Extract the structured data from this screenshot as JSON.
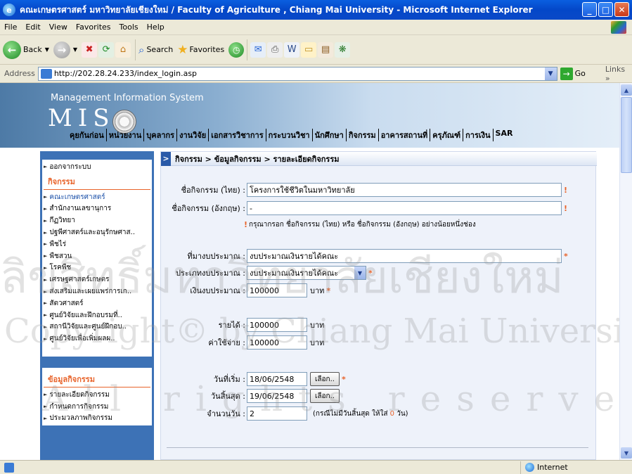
{
  "window": {
    "title": "คณะเกษตรศาสตร์ มหาวิทยาลัยเชียงใหม่ / Faculty of Agriculture , Chiang Mai University   - Microsoft Internet Explorer"
  },
  "menu": [
    "File",
    "Edit",
    "View",
    "Favorites",
    "Tools",
    "Help"
  ],
  "toolbar": {
    "back": "Back",
    "search": "Search",
    "favorites": "Favorites"
  },
  "address": {
    "label": "Address",
    "url": "http://202.28.24.233/index_login.asp",
    "go": "Go",
    "links": "Links"
  },
  "header": {
    "subtitle": "Management Information System",
    "logo": "MIS",
    "nav": [
      "คุยกันก่อน",
      "หน่วยงาน",
      "บุคลากร",
      "งานวิจัย",
      "เอกสารวิชาการ",
      "กระบวนวิชา",
      "นักศึกษา",
      "กิจกรรม",
      "อาคารสถานที่",
      "ครุภัณฑ์",
      "การเงิน",
      "SAR"
    ]
  },
  "sidebar": {
    "logout": "ออกจากระบบ",
    "section1": "กิจกรรม",
    "items": [
      "คณะเกษตรศาสตร์",
      "สำนักงานเลขานุการ",
      "กีฏวิทยา",
      "ปฐพีศาสตร์และอนุรักษศาส..",
      "พืชไร่",
      "พืชสวน",
      "โรคพืช",
      "เศรษฐศาสตร์เกษตร",
      "ส่งเสริมและเผยแพร่การเก..",
      "สัตวศาสตร์",
      "ศูนย์วิจัยและฝึกอบรมที่..",
      "สถานีวิจัยและศูนย์ฝึกอบ..",
      "ศูนย์วิจัยเพื่อเพิ่มผลผ.."
    ],
    "section2": "ข้อมูลกิจกรรม",
    "items2": [
      "รายละเอียดกิจกรรม",
      "กำหนดการกิจกรรม",
      "ประมวลภาพกิจกรรม"
    ]
  },
  "breadcrumb": "กิจกรรม > ข้อมูลกิจกรรม > รายละเอียดกิจกรรม",
  "form": {
    "name_th_label": "ชื่อกิจกรรม (ไทย) :",
    "name_th": "โครงการใช้ชีวิตในมหาวิทยาลัย",
    "name_en_label": "ชื่อกิจกรรม (อังกฤษ) :",
    "name_en": "-",
    "name_note": "กรุณากรอก ชื่อกิจกรรม (ไทย) หรือ ชื่อกิจกรรม (อังกฤษ) อย่างน้อยหนึ่งช่อง",
    "source_label": "ที่มางบประมาณ :",
    "source": "งบประมาณเงินรายได้คณะ",
    "type_label": "ประเภทงบประมาณ :",
    "type": "งบประมาณเงินรายได้คณะ",
    "budget_label": "เงินงบประมาณ :",
    "budget": "100000",
    "income_label": "รายได้ :",
    "income": "100000",
    "expense_label": "ค่าใช้จ่าย :",
    "expense": "100000",
    "unit": "บาท",
    "start_label": "วันที่เริ่ม :",
    "start": "18/06/2548",
    "end_label": "วันสิ้นสุด :",
    "end": "19/06/2548",
    "pick": "เลือก..",
    "days_label": "จำนวนวัน :",
    "days": "2",
    "days_note_a": "(กรณีไม่มีวันสิ้นสุด ให้ใส่",
    "days_note_zero": "0",
    "days_note_b": "วัน)",
    "required_mark": "!",
    "star": "*"
  },
  "status": {
    "zone": "Internet"
  },
  "watermark": {
    "line1": "ลิขสิทธิ์มหาวิทยาลัยเชียงใหม่",
    "line2": "Copyright© by Chiang Mai University",
    "line3": "All rights reserved"
  }
}
